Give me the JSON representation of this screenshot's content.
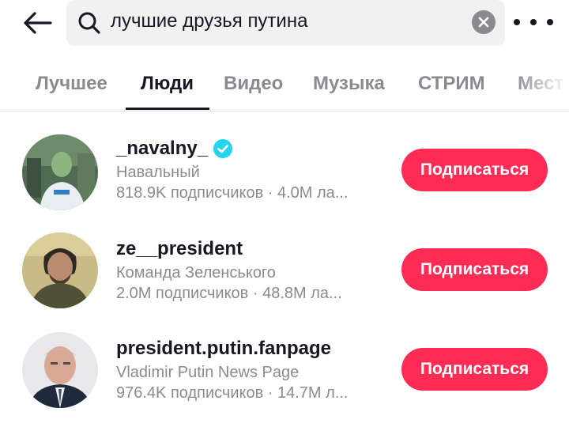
{
  "search": {
    "query": "лучшие друзья путина"
  },
  "tabs": [
    {
      "label": "Лучшее",
      "active": false
    },
    {
      "label": "Люди",
      "active": true
    },
    {
      "label": "Видео",
      "active": false
    },
    {
      "label": "Музыка",
      "active": false
    },
    {
      "label": "СТРИМ",
      "active": false
    },
    {
      "label": "Мест",
      "active": false
    }
  ],
  "results": [
    {
      "username": "_navalny_",
      "verified": true,
      "display_name": "Навальный",
      "stats": "818.9K подписчиков · 4.0M ла...",
      "follow_label": "Подписаться"
    },
    {
      "username": "ze__president",
      "verified": false,
      "display_name": "Команда Зеленського",
      "stats": "2.0M подписчиков · 48.8M ла...",
      "follow_label": "Подписаться"
    },
    {
      "username": "president.putin.fanpage",
      "verified": false,
      "display_name": "Vladimir Putin News Page",
      "stats": "976.4K подписчиков · 14.7M л...",
      "follow_label": "Подписаться"
    }
  ],
  "colors": {
    "accent": "#fe2c55",
    "verified": "#20d5ec",
    "text_primary": "#161823",
    "text_secondary": "#8a8b91"
  },
  "icons": {
    "back": "arrow-left-icon",
    "search": "search-icon",
    "clear": "clear-icon",
    "more": "more-icon",
    "verified": "verified-icon"
  }
}
